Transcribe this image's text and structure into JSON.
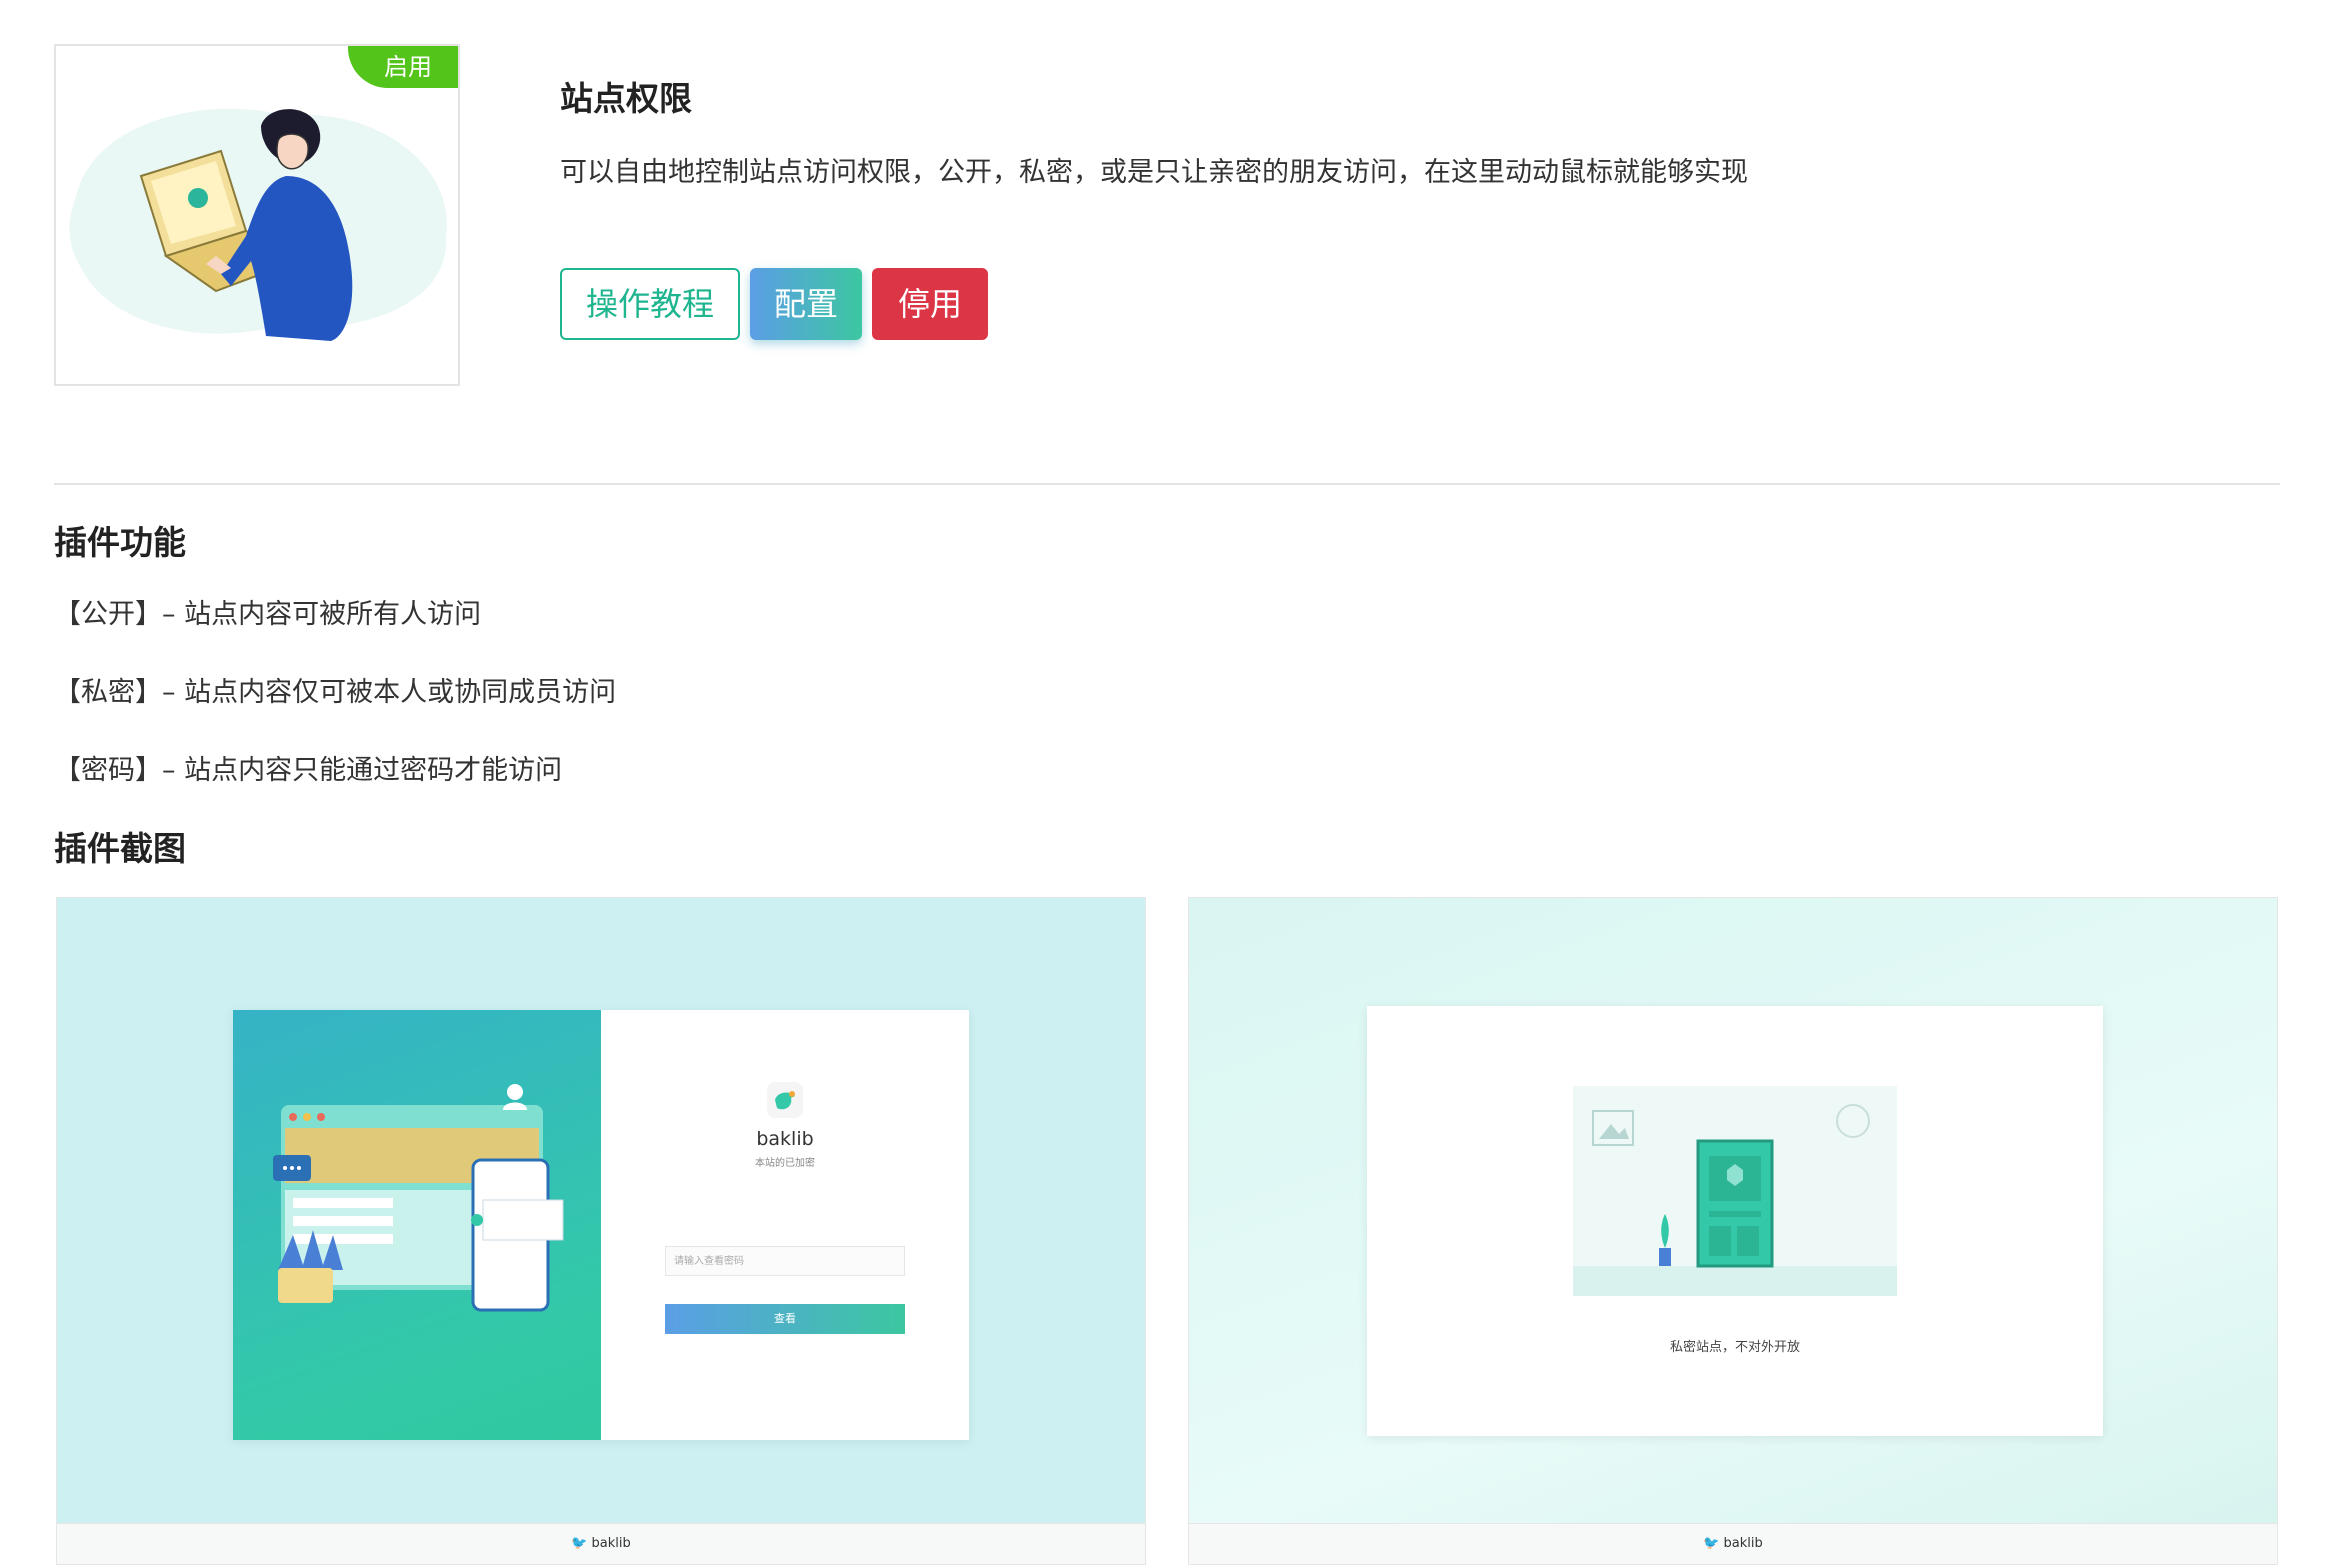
{
  "plugin": {
    "status_badge": "启用",
    "title": "站点权限",
    "description": "可以自由地控制站点访问权限，公开，私密，或是只让亲密的朋友访问，在这里动动鼠标就能够实现",
    "buttons": {
      "tutorial": "操作教程",
      "config": "配置",
      "disable": "停用"
    }
  },
  "features": {
    "title": "插件功能",
    "items": [
      "【公开】– 站点内容可被所有人访问",
      "【私密】– 站点内容仅可被本人或协同成员访问",
      "【密码】– 站点内容只能通过密码才能访问"
    ]
  },
  "screenshots": {
    "title": "插件截图",
    "login": {
      "brand": "baklib",
      "subtitle": "本站的已加密",
      "password_placeholder": "请输入查看密码",
      "view_button": "查看",
      "footer": "baklib"
    },
    "private": {
      "message": "私密站点，不对外开放",
      "footer": "baklib"
    }
  },
  "colors": {
    "accent_green": "#1fb58f",
    "badge_green": "#52c41a",
    "danger_red": "#dc3545",
    "gradient_blue": "#5b9ee6"
  }
}
